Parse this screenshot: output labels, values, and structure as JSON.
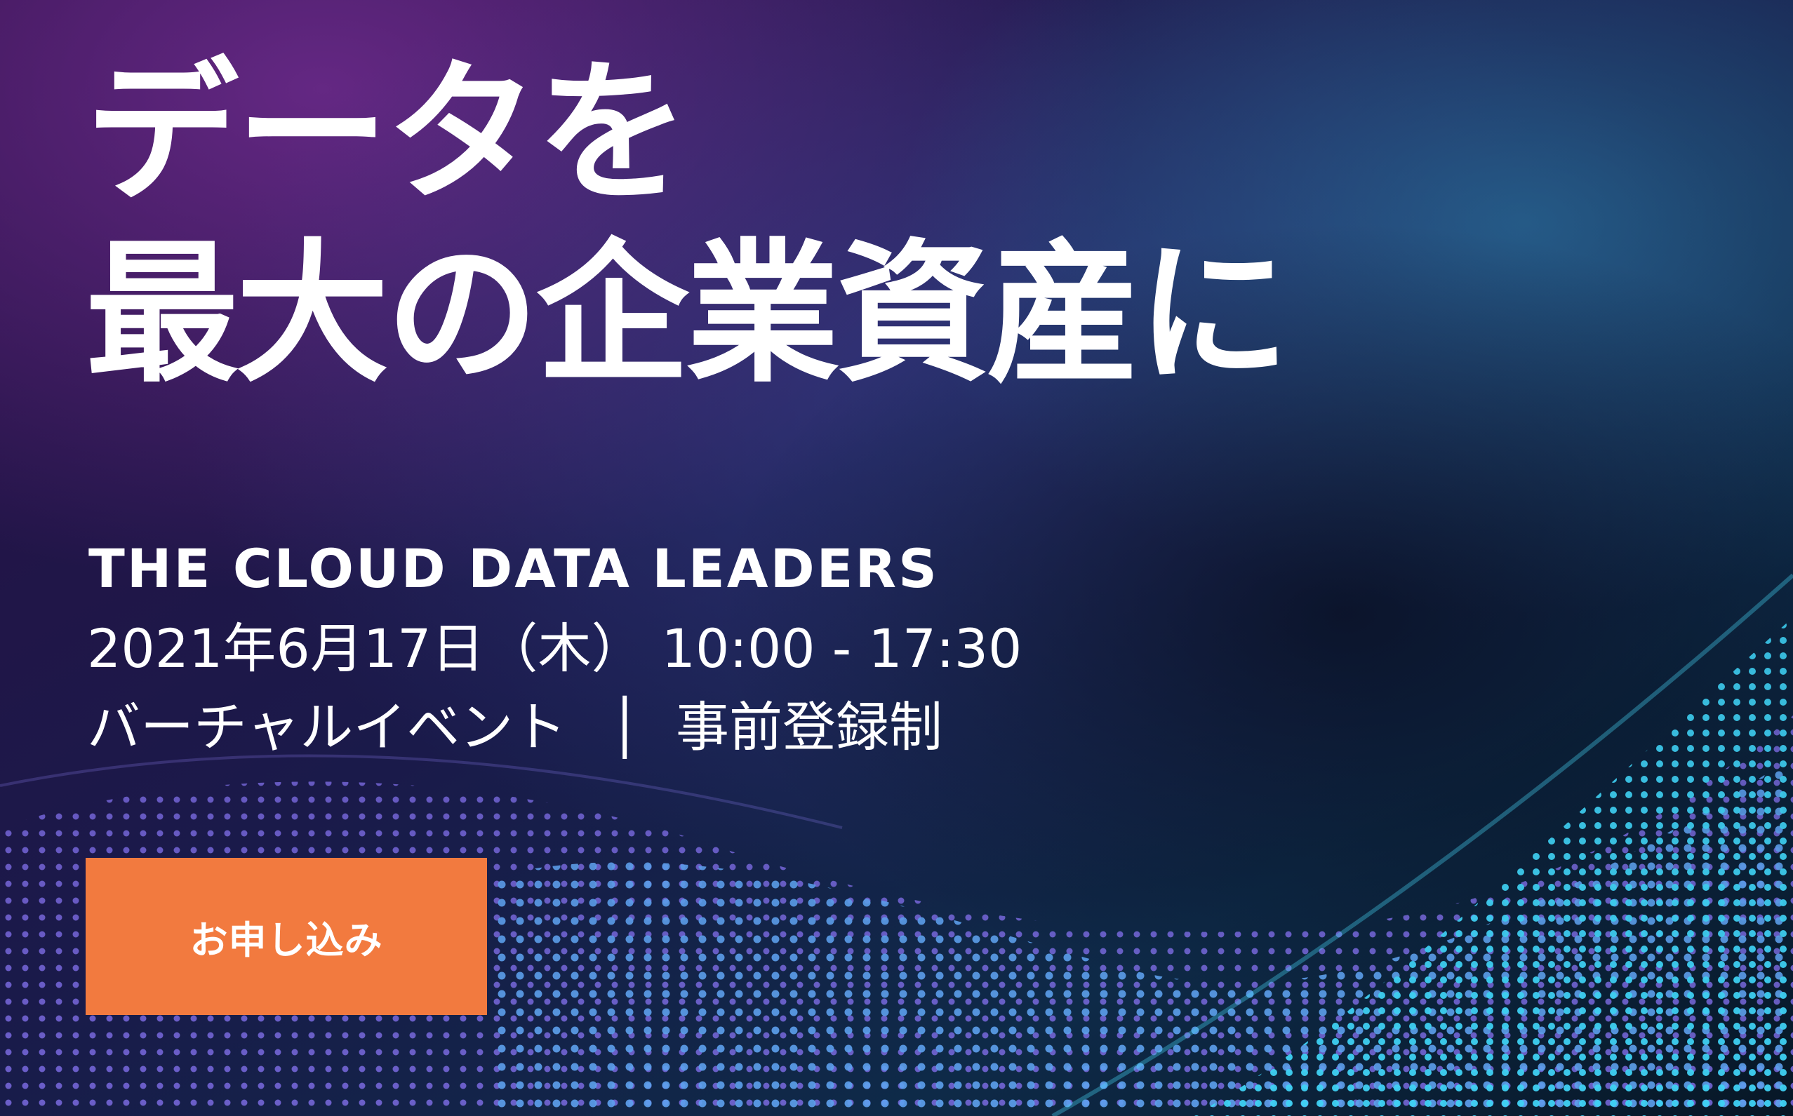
{
  "hero": {
    "headline_line1": "データを",
    "headline_line2": "最大の企業資産に",
    "event_name": "THE CLOUD DATA LEADERS",
    "event_date": "2021年6月17日（木） 10:00 - 17:30",
    "event_format": "バーチャルイベント",
    "event_separator": "│",
    "registration": "事前登録制",
    "cta_label": "お申し込み"
  },
  "colors": {
    "cta_background": "#f27a3f",
    "text": "#ffffff",
    "bg_purple": "#4a1d6e",
    "bg_cyan": "#2fc3ea"
  },
  "background_image": "abstract-dotted-data-wave"
}
